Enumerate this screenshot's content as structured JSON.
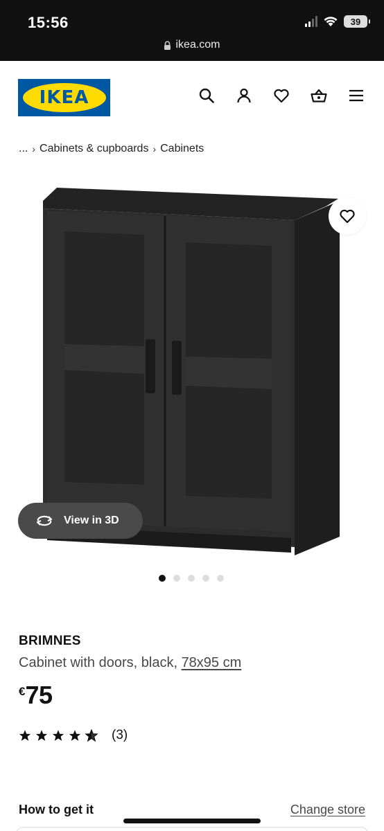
{
  "status_bar": {
    "time": "15:56",
    "battery": "39"
  },
  "url_bar": {
    "domain": "ikea.com",
    "lock_icon": "lock-icon"
  },
  "header": {
    "logo_text": "IKEA",
    "icons": [
      "search-icon",
      "account-icon",
      "favourites-icon",
      "basket-icon",
      "menu-icon"
    ]
  },
  "breadcrumb": {
    "ellipsis": "...",
    "items": [
      "Cabinets & cupboards",
      "Cabinets"
    ]
  },
  "product": {
    "view_3d_label": "View in 3D",
    "image_count": 5,
    "active_image": 1,
    "name": "BRIMNES",
    "description": "Cabinet with doors, black, ",
    "measure": "78x95 cm",
    "currency": "€",
    "price": "75",
    "rating_stars": 4.5,
    "rating_count": "(3)"
  },
  "fulfilment": {
    "title": "How to get it",
    "change_store_label": "Change store"
  },
  "colors": {
    "ikea_blue": "#0058a3",
    "ikea_yellow": "#ffdb00",
    "cabinet_black": "#2a2a2a"
  }
}
